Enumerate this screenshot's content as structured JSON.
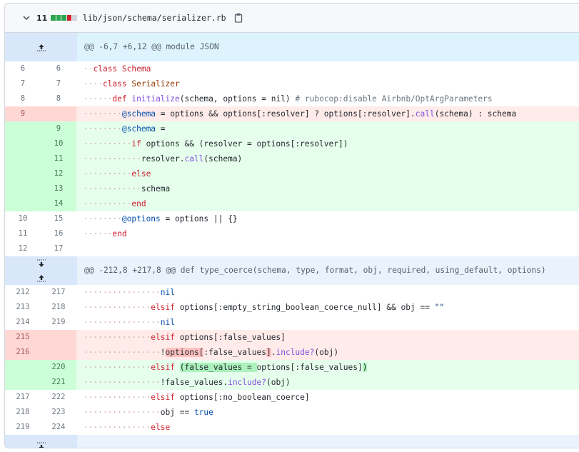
{
  "file": {
    "changes_count": "11",
    "diffstat": [
      "#2da44e",
      "#2da44e",
      "#2da44e",
      "#cf222e",
      "#d0d7de"
    ],
    "path": "lib/json/schema/serializer.rb"
  },
  "hunks": [
    {
      "header": "@@ -6,7 +6,12 @@ module JSON"
    },
    {
      "header": "@@ -212,8 +217,8 @@ def type_coerce(schema, type, format, obj, required, using_default, options)"
    }
  ],
  "lines_a": [
    {
      "type": "ctx",
      "old": "6",
      "new": "6"
    },
    {
      "type": "ctx",
      "old": "7",
      "new": "7"
    },
    {
      "type": "ctx",
      "old": "8",
      "new": "8"
    },
    {
      "type": "del",
      "old": "9",
      "new": ""
    },
    {
      "type": "add",
      "old": "",
      "new": "9"
    },
    {
      "type": "add",
      "old": "",
      "new": "10"
    },
    {
      "type": "add",
      "old": "",
      "new": "11"
    },
    {
      "type": "add",
      "old": "",
      "new": "12"
    },
    {
      "type": "add",
      "old": "",
      "new": "13"
    },
    {
      "type": "add",
      "old": "",
      "new": "14"
    },
    {
      "type": "ctx",
      "old": "10",
      "new": "15"
    },
    {
      "type": "ctx",
      "old": "11",
      "new": "16"
    },
    {
      "type": "ctx",
      "old": "12",
      "new": "17"
    }
  ],
  "lines_b": [
    {
      "type": "ctx",
      "old": "212",
      "new": "217"
    },
    {
      "type": "ctx",
      "old": "213",
      "new": "218"
    },
    {
      "type": "ctx",
      "old": "214",
      "new": "219"
    },
    {
      "type": "del",
      "old": "215",
      "new": ""
    },
    {
      "type": "del",
      "old": "216",
      "new": ""
    },
    {
      "type": "add",
      "old": "",
      "new": "220"
    },
    {
      "type": "add",
      "old": "",
      "new": "221"
    },
    {
      "type": "ctx",
      "old": "217",
      "new": "222"
    },
    {
      "type": "ctx",
      "old": "218",
      "new": "223"
    },
    {
      "type": "ctx",
      "old": "219",
      "new": "224"
    }
  ],
  "code_a": {
    "l6": "class Schema",
    "l7a": "class",
    "l7b": "Serializer",
    "l8a": "def",
    "l8b": "initialize",
    "l8c": "(schema, options = nil) ",
    "l8d": "# rubocop:disable Airbnb/OptArgParameters",
    "l9a": "@schema",
    "l9b": " = options && options[:resolver] ? options[:resolver].",
    "l9c": "call",
    "l9d": "(schema) : schema",
    "n9a": "@schema",
    "n9b": " =",
    "n10a": "if",
    "n10b": " options && (resolver = options[:resolver])",
    "n11a": "resolver.",
    "n11b": "call",
    "n11c": "(schema)",
    "n12": "else",
    "n13": "schema",
    "n14": "end",
    "n15a": "@options",
    "n15b": " = options || {}",
    "n16": "end",
    "n17": ""
  },
  "code_b": {
    "l212": "nil",
    "l213a": "elsif",
    "l213b": " options[:empty_string_boolean_coerce_null] && obj == ",
    "l213c": "\"\"",
    "l214": "nil",
    "l215a": "elsif",
    "l215b": " options[:false_values]",
    "l216a": "!",
    "l216b": "options[",
    "l216c": ":false_values",
    "l216d": "]",
    "l216e": ".",
    "l216f": "include?",
    "l216g": "(obj)",
    "n220a": "elsif",
    "n220b": " ",
    "n220c": "(false_values = ",
    "n220d": "options[:false_values]",
    "n220e": ")",
    "n221a": "!false_values.",
    "n221b": "include?",
    "n221c": "(obj)",
    "n222a": "elsif",
    "n222b": " options[:no_boolean_coerce]",
    "n223a": "obj == ",
    "n223b": "true",
    "n224": "else"
  }
}
